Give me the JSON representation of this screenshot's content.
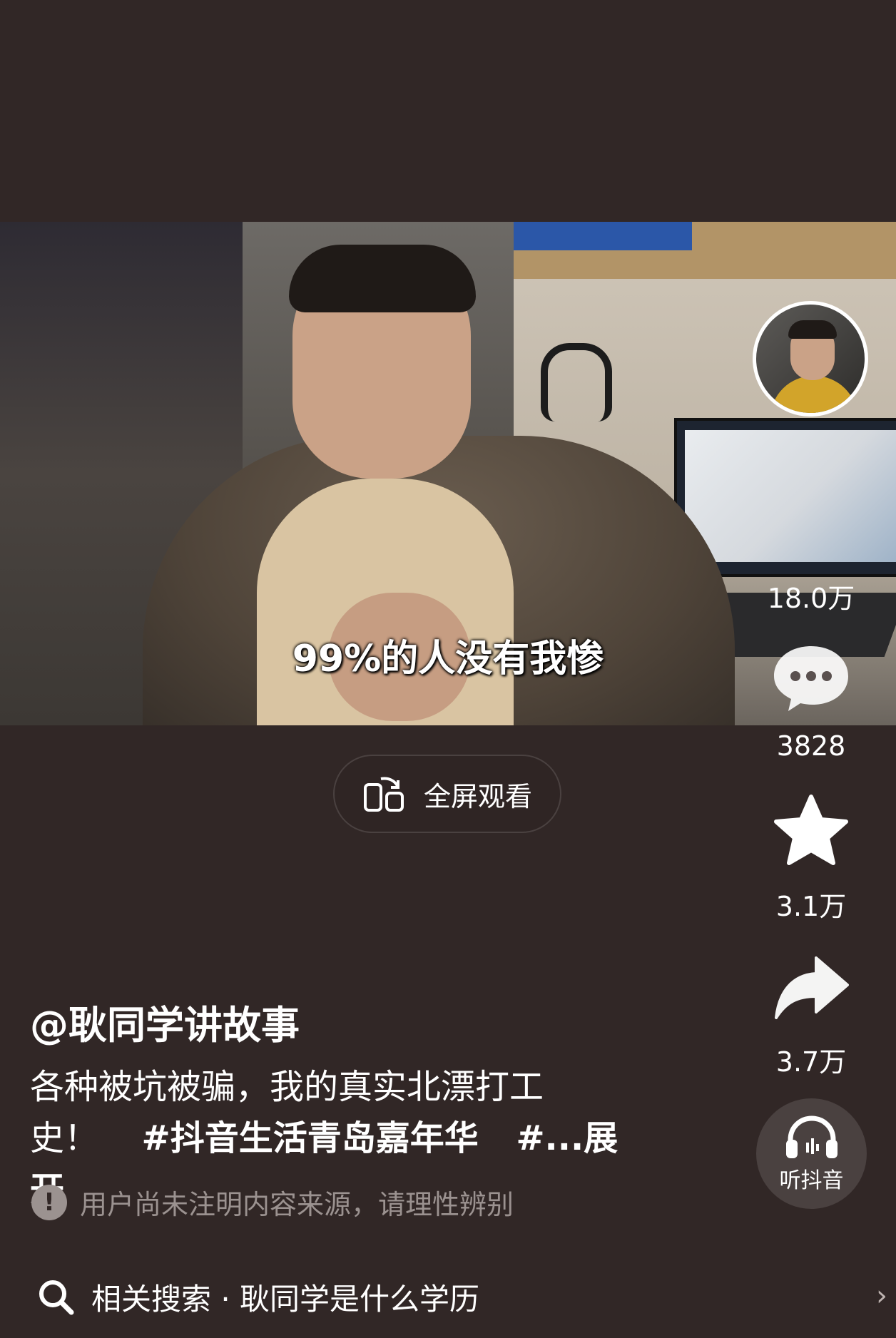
{
  "video": {
    "caption": "99%的人没有我惨",
    "fullscreen_label": "全屏观看"
  },
  "side_actions": {
    "likes": "18.0万",
    "comments": "3828",
    "favorites": "3.1万",
    "shares": "3.7万",
    "listen_label": "听抖音"
  },
  "post": {
    "author": "@耿同学讲故事",
    "description_line1": "各种被坑被骗，我的真实北漂打工",
    "description_line2_prefix": "史！",
    "hashtag1": "#抖音生活青岛嘉年华",
    "hashtag2": "#...",
    "expand_label": "展开",
    "notice": "用户尚未注明内容来源，请理性辨别"
  },
  "search": {
    "text": "相关搜索 · 耿同学是什么学历"
  },
  "icons": {
    "fullscreen": "fullscreen-rotate-icon",
    "comment": "comment-bubble-icon",
    "favorite": "star-icon",
    "share": "share-arrow-icon",
    "listen": "headphones-icon",
    "notice": "info-exclamation-icon",
    "search": "search-icon"
  }
}
